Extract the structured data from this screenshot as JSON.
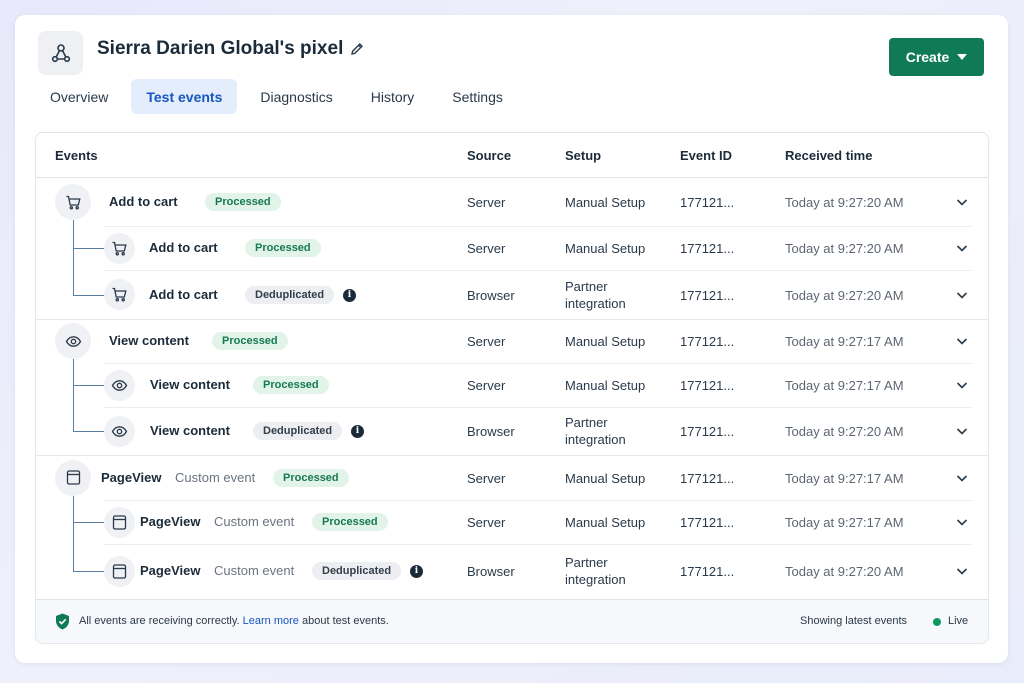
{
  "header": {
    "title": "Sierra Darien Global's pixel",
    "icon": "pixel-network-icon",
    "create_label": "Create"
  },
  "tabs": [
    {
      "label": "Overview",
      "active": false
    },
    {
      "label": "Test events",
      "active": true
    },
    {
      "label": "Diagnostics",
      "active": false
    },
    {
      "label": "History",
      "active": false
    },
    {
      "label": "Settings",
      "active": false
    }
  ],
  "table": {
    "columns": [
      "Events",
      "Source",
      "Setup",
      "Event ID",
      "Received time"
    ],
    "groups": [
      {
        "icon": "cart-icon",
        "parent": {
          "name": "Add to cart",
          "custom": "",
          "status": "Processed",
          "source": "Server",
          "setup": "Manual Setup",
          "event_id": "177121...",
          "time": "Today at 9:27:20 AM"
        },
        "children": [
          {
            "name": "Add to cart",
            "custom": "",
            "status": "Processed",
            "info": false,
            "source": "Server",
            "setup": "Manual Setup",
            "event_id": "177121...",
            "time": "Today at 9:27:20 AM"
          },
          {
            "name": "Add to cart",
            "custom": "",
            "status": "Deduplicated",
            "info": true,
            "source": "Browser",
            "setup": "Partner integration",
            "event_id": "177121...",
            "time": "Today at 9:27:20 AM"
          }
        ]
      },
      {
        "icon": "eye-icon",
        "parent": {
          "name": "View content",
          "custom": "",
          "status": "Processed",
          "source": "Server",
          "setup": "Manual Setup",
          "event_id": "177121...",
          "time": "Today at 9:27:17 AM"
        },
        "children": [
          {
            "name": "View content",
            "custom": "",
            "status": "Processed",
            "info": false,
            "source": "Server",
            "setup": "Manual Setup",
            "event_id": "177121...",
            "time": "Today at 9:27:17 AM"
          },
          {
            "name": "View content",
            "custom": "",
            "status": "Deduplicated",
            "info": true,
            "source": "Browser",
            "setup": "Partner integration",
            "event_id": "177121...",
            "time": "Today at 9:27:20 AM"
          }
        ]
      },
      {
        "icon": "page-icon",
        "parent": {
          "name": "PageView",
          "custom": "Custom event",
          "status": "Processed",
          "source": "Server",
          "setup": "Manual Setup",
          "event_id": "177121...",
          "time": "Today at 9:27:17 AM"
        },
        "children": [
          {
            "name": "PageView",
            "custom": "Custom event",
            "status": "Processed",
            "info": false,
            "source": "Server",
            "setup": "Manual Setup",
            "event_id": "177121...",
            "time": "Today at 9:27:17 AM"
          },
          {
            "name": "PageView",
            "custom": "Custom event",
            "status": "Deduplicated",
            "info": true,
            "source": "Browser",
            "setup": "Partner integration",
            "event_id": "177121...",
            "time": "Today at 9:27:20 AM"
          }
        ]
      }
    ]
  },
  "footer": {
    "message_prefix": "All events are receiving correctly.",
    "link_text": "Learn more",
    "message_suffix": "about test events.",
    "latest_label": "Showing latest events",
    "live_label": "Live"
  },
  "colors": {
    "accent": "#0f7a55",
    "tab_active": "#1557c2",
    "processed_bg": "#e2f3ea",
    "processed_text": "#167a4e",
    "live": "#0f9a5e"
  }
}
